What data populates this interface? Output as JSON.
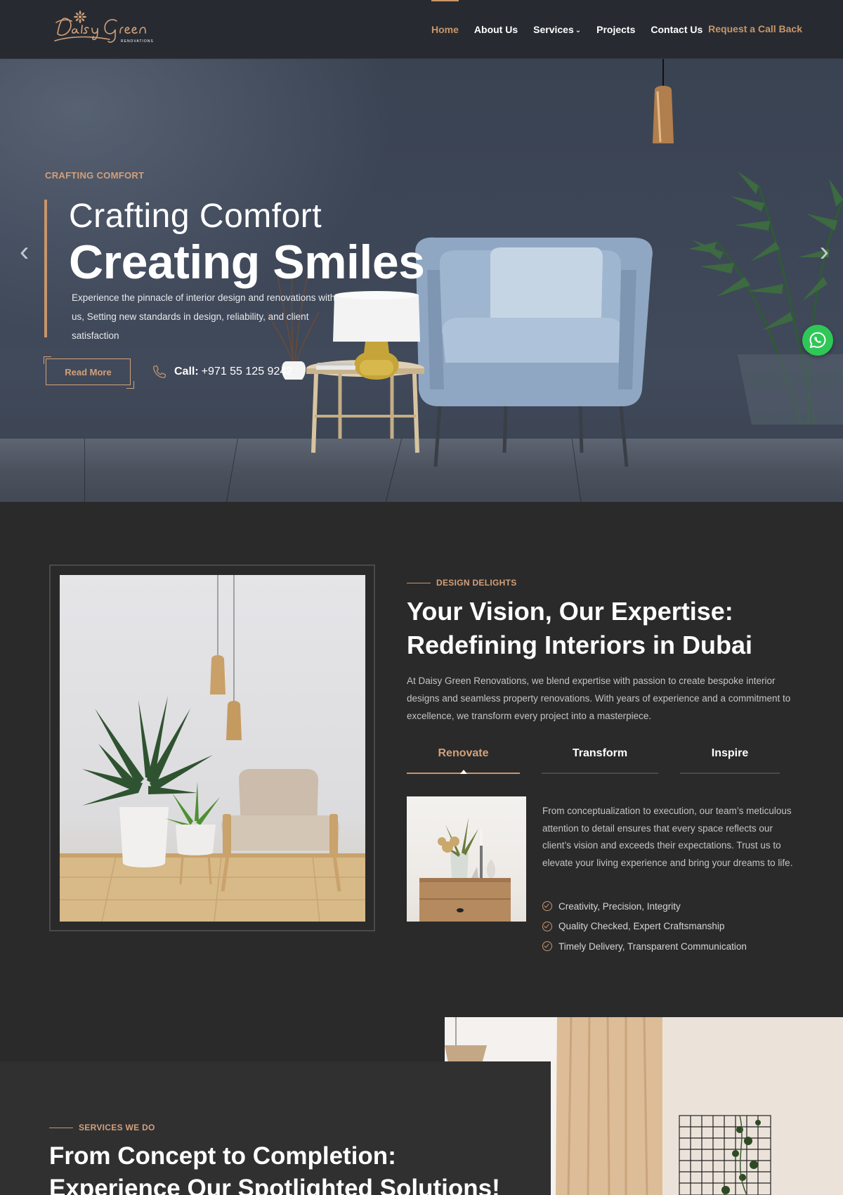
{
  "brand": {
    "logo_script": "Daisy Green",
    "logo_sub": "RENOVATIONS"
  },
  "nav": {
    "items": [
      {
        "label": "Home",
        "active": true
      },
      {
        "label": "About Us"
      },
      {
        "label": "Services",
        "has_dropdown": true
      },
      {
        "label": "Projects"
      },
      {
        "label": "Contact Us"
      }
    ],
    "cta": "Request a Call Back"
  },
  "hero": {
    "eyebrow": "CRAFTING COMFORT",
    "title_line1": "Crafting Comfort",
    "title_line2": "Creating Smiles",
    "text": "Experience the pinnacle of interior design and renovations with us, Setting new standards in design, reliability, and client satisfaction",
    "read_more": "Read More",
    "call_label": "Call:",
    "call_number": "+971 55 125 9242"
  },
  "about": {
    "eyebrow": "DESIGN DELIGHTS",
    "title": "Your Vision, Our Expertise: Redefining Interiors in Dubai",
    "text": "At Daisy Green Renovations, we blend expertise with passion to create bespoke interior designs and seamless property renovations. With years of experience and a commitment to excellence, we transform every project into a masterpiece.",
    "tabs": [
      {
        "label": "Renovate",
        "active": true
      },
      {
        "label": "Transform"
      },
      {
        "label": "Inspire"
      }
    ],
    "tab_text": "From conceptualization to execution, our team’s meticulous attention to detail ensures that every space reflects our client’s vision and exceeds their expectations. Trust us to elevate your living experience and bring your dreams to life.",
    "checklist": [
      "Creativity, Precision, Integrity",
      "Quality Checked, Expert Craftsmanship",
      "Timely Delivery, Transparent Communication"
    ]
  },
  "services": {
    "eyebrow": "SERVICES WE DO",
    "title_line1": "From Concept to Completion:",
    "title_line2": "Experience Our Spotlighted Solutions!"
  },
  "colors": {
    "accent": "#c9956a",
    "background": "#2a2a2b",
    "header": "#272b31",
    "whatsapp": "#2fc758"
  },
  "icons": [
    "phone-icon",
    "whatsapp-icon",
    "check-circle-icon",
    "chevron-left-icon",
    "chevron-right-icon",
    "chevron-down-icon"
  ]
}
